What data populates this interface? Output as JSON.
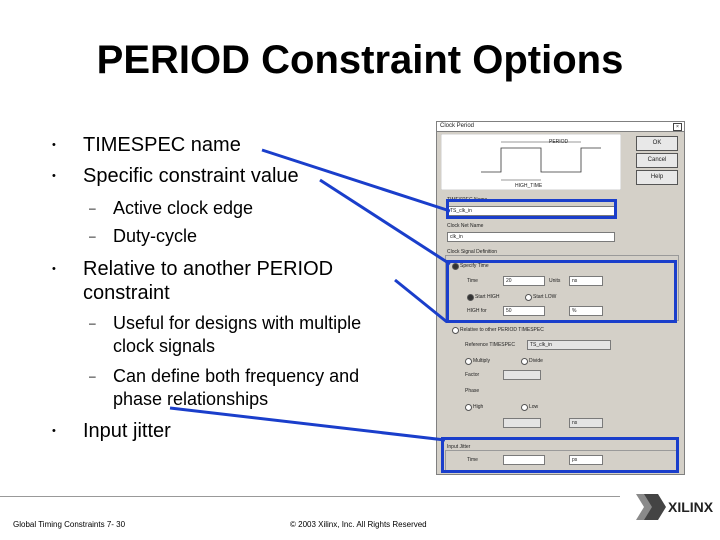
{
  "slide": {
    "title": "PERIOD Constraint Options",
    "bullets": [
      {
        "text": "TIMESPEC name"
      },
      {
        "text": "Specific constraint value"
      },
      {
        "text": "Relative to another PERIOD constraint"
      },
      {
        "text": "Input jitter"
      }
    ],
    "sub_bullets": [
      {
        "text": "Active clock edge"
      },
      {
        "text": "Duty-cycle"
      },
      {
        "text": "Useful for designs with multiple clock signals"
      },
      {
        "text": "Can define both frequency and phase relationships"
      }
    ],
    "footer_left": "Global Timing Constraints  7- 30",
    "footer_center": "© 2003 Xilinx, Inc. All Rights Reserved",
    "logo_text": "XILINX"
  },
  "dialog": {
    "title": "Clock Period",
    "close_glyph": "×",
    "buttons": {
      "ok": "OK",
      "cancel": "Cancel",
      "help": "Help"
    },
    "waveform_labels": {
      "period": "PERIOD",
      "high_time": "HIGH_TIME"
    },
    "timespec_group": {
      "label": "TIMESPEC Name",
      "value": "TS_clk_in"
    },
    "clock_net_label": "Clock Net Name",
    "clock_net_value": "clk_in",
    "clock_signal_group": {
      "label": "Clock Signal Definition",
      "specify_time_label": "Specify Time",
      "time_label": "Time",
      "time_value": "20",
      "time_units": "ns",
      "start_high": "Start HIGH",
      "start_low": "Start LOW",
      "high_for": "HIGH for",
      "high_value": "50",
      "high_units": "%"
    },
    "relative_label": "Relative to other PERIOD TIMESPEC",
    "reference_label": "Reference TIMESPEC",
    "reference_value": "TS_clk_in",
    "multiply": "Multiply",
    "divide": "Divide",
    "factor": "Factor",
    "phase": "Phase",
    "hl_high": "High",
    "hl_low": "Low",
    "phase_units": "ns",
    "input_jitter_group": {
      "label": "Input Jitter",
      "time_label": "Time",
      "units": "ps"
    }
  },
  "colors": {
    "highlight": "#1a3ecb",
    "pointer_line": "#1a3ecb",
    "dialog_bg": "#d4d0c8"
  }
}
